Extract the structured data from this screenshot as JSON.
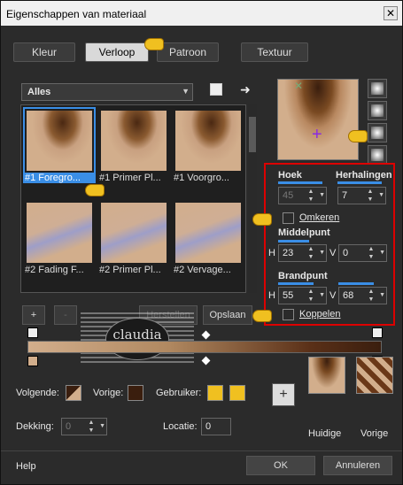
{
  "window": {
    "title": "Eigenschappen van materiaal",
    "close": "✕"
  },
  "tabs": [
    {
      "label": "Kleur"
    },
    {
      "label": "Verloop"
    },
    {
      "label": "Patroon"
    },
    {
      "label": "Textuur"
    }
  ],
  "library": {
    "category": "Alles",
    "thumbs": [
      {
        "label": "#1 Foregro..."
      },
      {
        "label": "#1 Primer Pl..."
      },
      {
        "label": "#1 Voorgro..."
      },
      {
        "label": "#2 Fading F..."
      },
      {
        "label": "#2 Primer Pl..."
      },
      {
        "label": "#2 Vervage..."
      }
    ]
  },
  "controls": {
    "hoek_label": "Hoek",
    "hoek_value": "45",
    "herhalingen_label": "Herhalingen",
    "herhalingen_value": "7",
    "omkeren_label": "Omkeren",
    "middelpunt_label": "Middelpunt",
    "mid_h_label": "H",
    "mid_h_value": "23",
    "mid_v_label": "V",
    "mid_v_value": "0",
    "brandpunt_label": "Brandpunt",
    "brand_h_label": "H",
    "brand_h_value": "55",
    "brand_v_label": "V",
    "brand_v_value": "68",
    "koppelen_label": "Koppelen"
  },
  "editor": {
    "add_label": "+",
    "remove_label": "-",
    "restore_label": "Herstellen",
    "save_label": "Opslaan"
  },
  "watermark": {
    "text": "claudia"
  },
  "bottom": {
    "volgende_label": "Volgende:",
    "vorige_label": "Vorige:",
    "gebruiker_label": "Gebruiker:",
    "dekking_label": "Dekking:",
    "dekking_value": "0",
    "locatie_label": "Locatie:",
    "locatie_value": "0",
    "add_label": "+",
    "huidige_label": "Huidige",
    "vorige_thumb_label": "Vorige"
  },
  "footer": {
    "help_label": "Help",
    "ok_label": "OK",
    "cancel_label": "Annuleren"
  },
  "colors": {
    "accent": "#3a8ee6",
    "highlight_box": "#dd0000",
    "user_swatch": "#f0c020"
  }
}
